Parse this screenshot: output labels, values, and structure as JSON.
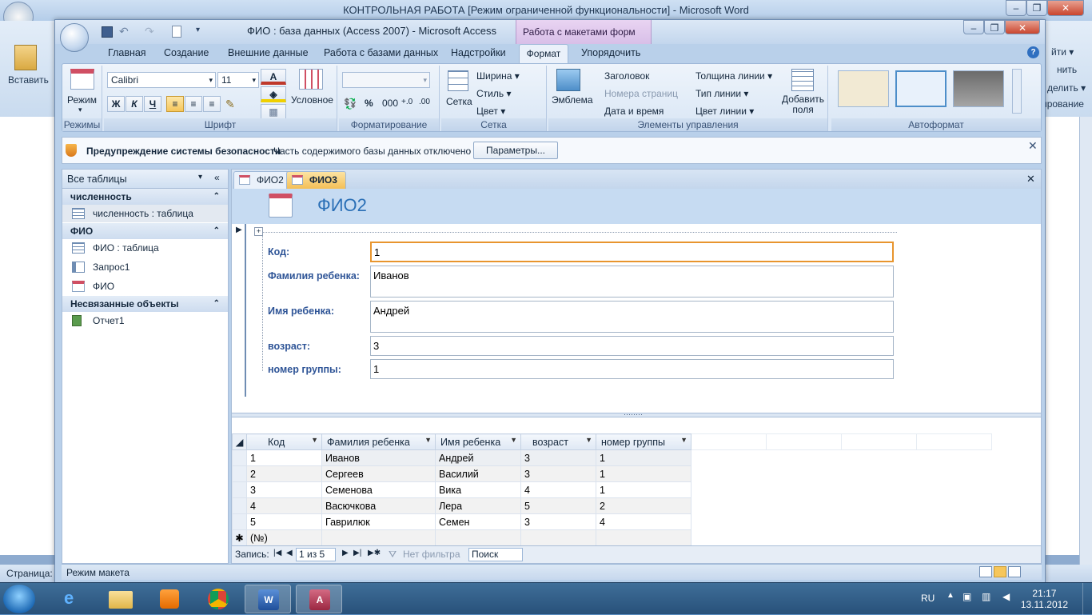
{
  "word": {
    "title": "КОНТРОЛЬНАЯ РАБОТА [Режим ограниченной функциональности]  -  Microsoft Word",
    "paste_label": "Вставить",
    "status_label": "Страница:",
    "right_labels": [
      "йти ▾",
      "нить",
      "делить ▾",
      "ирование"
    ]
  },
  "access": {
    "title": "ФИО : база данных (Access 2007)  -  Microsoft Access",
    "context_tab": "Работа с макетами форм",
    "tabs": [
      "Главная",
      "Создание",
      "Внешние данные",
      "Работа с базами данных",
      "Надстройки",
      "Формат",
      "Упорядочить"
    ],
    "ribbon": {
      "modes": {
        "button": "Режим",
        "label": "Режимы"
      },
      "font": {
        "name": "Calibri",
        "size": "11",
        "bold": "Ж",
        "italic": "К",
        "underline": "Ч",
        "conditional": "Условное",
        "label": "Шрифт"
      },
      "formatting": {
        "label": "Форматирование",
        "percent": "%",
        "thousands": "000"
      },
      "gridlines": {
        "button": "Сетка",
        "width": "Ширина ▾",
        "style": "Стиль ▾",
        "color": "Цвет ▾",
        "label": "Сетка"
      },
      "controls": {
        "logo": "Эмблема",
        "title": "Заголовок",
        "page_numbers": "Номера страниц",
        "date_time": "Дата и время",
        "line_thickness": "Толщина линии ▾",
        "line_type": "Тип линии ▾",
        "line_color": "Цвет линии ▾",
        "add_fields": "Добавить\nполя",
        "label": "Элементы управления"
      },
      "autoformat": {
        "label": "Автоформат"
      }
    },
    "security": {
      "title": "Предупреждение системы безопасности",
      "message": "Часть содержимого базы данных отключено",
      "button": "Параметры..."
    },
    "nav": {
      "header": "Все таблицы",
      "groups": [
        {
          "name": "численность",
          "items": [
            "численность : таблица"
          ]
        },
        {
          "name": "ФИО",
          "items": [
            "ФИО : таблица",
            "Запрос1",
            "ФИО"
          ]
        },
        {
          "name": "Несвязанные объекты",
          "items": [
            "Отчет1"
          ]
        }
      ]
    },
    "doc_tabs": [
      "ФИО2",
      "ФИО3"
    ],
    "form": {
      "title": "ФИО2",
      "fields": [
        {
          "label": "Код:",
          "value": "1"
        },
        {
          "label": "Фамилия ребенка:",
          "value": "Иванов"
        },
        {
          "label": "Имя ребенка:",
          "value": "Андрей"
        },
        {
          "label": "возраст:",
          "value": "3"
        },
        {
          "label": "номер группы:",
          "value": "1"
        }
      ]
    },
    "datasheet": {
      "columns": [
        "Код",
        "Фамилия ребенка",
        "Имя ребенка",
        "возраст",
        "номер группы"
      ],
      "rows": [
        [
          "1",
          "Иванов",
          "Андрей",
          "3",
          "1"
        ],
        [
          "2",
          "Сергеев",
          "Василий",
          "3",
          "1"
        ],
        [
          "3",
          "Семенова",
          "Вика",
          "4",
          "1"
        ],
        [
          "4",
          "Васючкова",
          "Лера",
          "5",
          "2"
        ],
        [
          "5",
          "Гаврилюк",
          "Семен",
          "3",
          "4"
        ]
      ],
      "new_row": "(№)"
    },
    "record_nav": {
      "label": "Запись:",
      "position": "1 из 5",
      "filter": "Нет фильтра",
      "search": "Поиск"
    },
    "status": "Режим макета"
  },
  "taskbar": {
    "lang": "RU",
    "time": "21:17",
    "date": "13.11.2012"
  }
}
